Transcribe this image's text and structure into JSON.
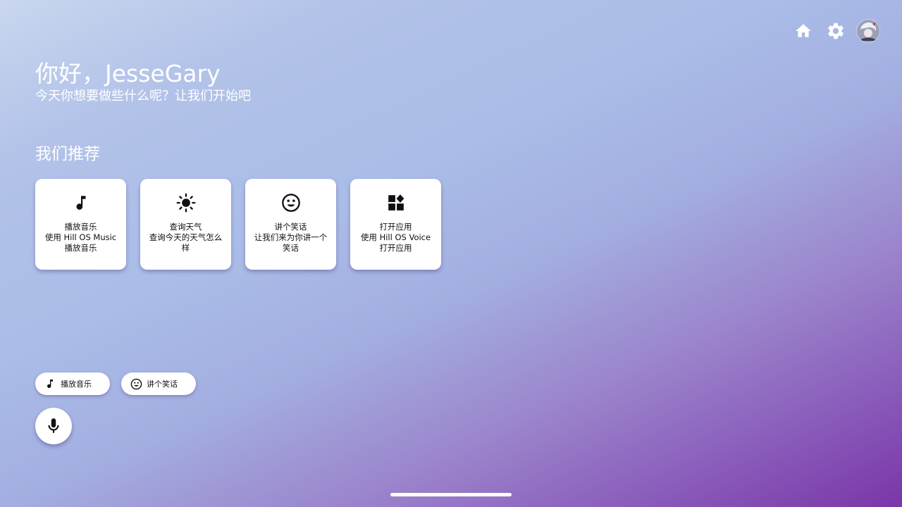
{
  "header": {
    "home_icon": "home-icon",
    "settings_icon": "gear-icon",
    "avatar": "user-avatar"
  },
  "greeting": {
    "title": "你好，JesseGary",
    "subtitle": "今天你想要做些什么呢？让我们开始吧"
  },
  "recommend": {
    "title": "我们推荐",
    "cards": [
      {
        "icon": "music-note-icon",
        "lines": [
          "播放音乐",
          "使用 Hill OS Music",
          "播放音乐"
        ]
      },
      {
        "icon": "sun-icon",
        "lines": [
          "查询天气",
          "查询今天的天气怎么",
          "样"
        ]
      },
      {
        "icon": "smiley-icon",
        "lines": [
          "讲个笑话",
          "让我们来为你讲一个",
          "笑话"
        ]
      },
      {
        "icon": "apps-icon",
        "lines": [
          "打开应用",
          "使用 Hill OS Voice",
          "打开应用"
        ]
      }
    ]
  },
  "chips": [
    {
      "icon": "music-note-icon",
      "label": "播放音乐"
    },
    {
      "icon": "smiley-icon",
      "label": "讲个笑话"
    }
  ],
  "mic": {
    "icon": "microphone-icon"
  }
}
